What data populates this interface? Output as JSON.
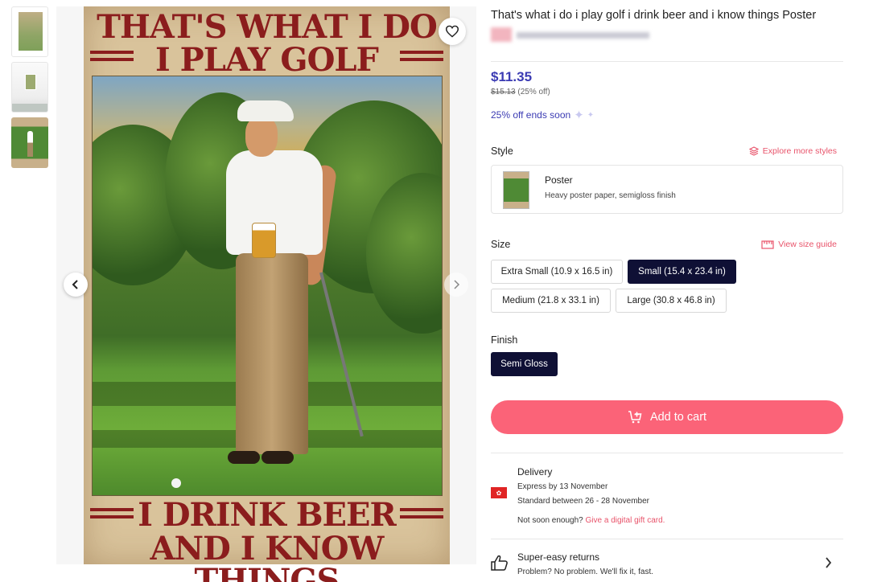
{
  "product": {
    "title": "That's what i do i play golf i drink beer and i know things Poster",
    "price": "$11.35",
    "original_price": "$15.13",
    "discount_text": "(25% off)",
    "sale_note": "25% off ends soon"
  },
  "poster_art": {
    "line1": "THAT'S WHAT I DO",
    "line2": "I PLAY GOLF",
    "line3": "I DRINK BEER",
    "line4": "AND I KNOW THINGS"
  },
  "gallery": {
    "thumbnail_count": 3,
    "prev_icon": "chevron-left-icon",
    "next_icon": "chevron-right-icon",
    "favorite_icon": "heart-icon"
  },
  "style": {
    "label": "Style",
    "explore_link": "Explore more styles",
    "selected_name": "Poster",
    "selected_desc": "Heavy poster paper, semigloss finish"
  },
  "size": {
    "label": "Size",
    "guide_link": "View size guide",
    "options": [
      {
        "label": "Extra Small (10.9 x 16.5 in)",
        "selected": false
      },
      {
        "label": "Small (15.4 x 23.4 in)",
        "selected": true
      },
      {
        "label": "Medium (21.8 x 33.1 in)",
        "selected": false
      },
      {
        "label": "Large (30.8 x 46.8 in)",
        "selected": false
      }
    ]
  },
  "finish": {
    "label": "Finish",
    "options": [
      {
        "label": "Semi Gloss",
        "selected": true
      }
    ]
  },
  "cart": {
    "button_label": "Add to cart",
    "icon": "cart-plus-icon"
  },
  "delivery": {
    "heading": "Delivery",
    "express": "Express by 13 November",
    "standard": "Standard between 26 - 28 November",
    "not_soon": "Not soon enough?",
    "gift_link": "Give a digital gift card."
  },
  "returns": {
    "heading": "Super-easy returns",
    "text": "Problem? No problem. We'll fix it, fast.",
    "icon": "thumbs-up-icon"
  },
  "colors": {
    "accent_blue": "#3b3bb3",
    "accent_pink": "#fb6378",
    "selected_chip": "#0f1035",
    "link_pink": "#e8536a"
  }
}
